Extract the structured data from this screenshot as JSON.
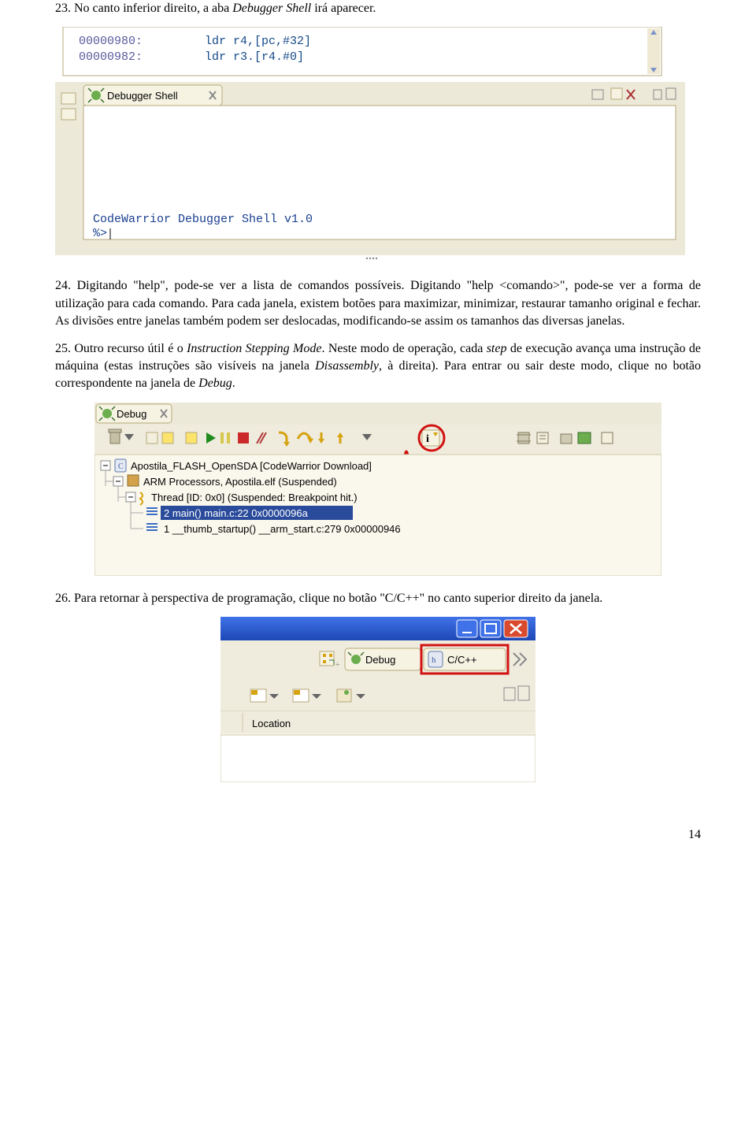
{
  "para23": {
    "prefix": "23. No canto inferior direito, a aba ",
    "shell": "Debugger Shell",
    "suffix": " irá aparecer."
  },
  "shell_panel": {
    "addr1": "00000980:",
    "code1": "ldr r4,[pc,#32]",
    "addr2": "00000982:",
    "code2": "ldr r3.[r4.#0]",
    "tab1": "Debugger Shell",
    "body1": "CodeWarrior Debugger Shell v1.0",
    "prompt": "%>"
  },
  "para24a": "24. Digitando \"help\", pode-se ver a lista de comandos possíveis. Digitando \"help <comando>\", pode-se ver a forma de utilização para cada comando. Para cada janela, existem botões para maximizar, minimizar, restaurar tamanho original e fechar. As divisões entre janelas também podem ser deslocadas, modificando-se assim os tamanhos das diversas janelas.",
  "para25": {
    "t1": "25. Outro recurso útil é o ",
    "ism": "Instruction Stepping Mode",
    "t2": ". Neste modo de operação, cada ",
    "step": "step",
    "t3": " de execução avança uma instrução de máquina (estas instruções são visíveis na janela ",
    "dis": "Disassembly",
    "t4": ", à direita). Para entrar ou sair deste modo, clique no botão correspondente na janela de ",
    "debug": "Debug",
    "t5": "."
  },
  "debug_panel": {
    "tab": "Debug",
    "proj": "Apostila_FLASH_OpenSDA [CodeWarrior Download]",
    "arm": "ARM Processors, Apostila.elf (Suspended)",
    "thread": "Thread [ID: 0x0] (Suspended: Breakpoint hit.)",
    "frame0": "2 main() main.c:22 0x0000096a",
    "frame1": "1 __thumb_startup() __arm_start.c:279 0x00000946",
    "ibtn": "i"
  },
  "para26": "26. Para retornar à perspectiva de programação, clique no botão \"C/C++\" no canto superior direito da janela.",
  "persp_panel": {
    "debug": "Debug",
    "cpp": "C/C++",
    "loc": "Location"
  },
  "page_number": "14"
}
